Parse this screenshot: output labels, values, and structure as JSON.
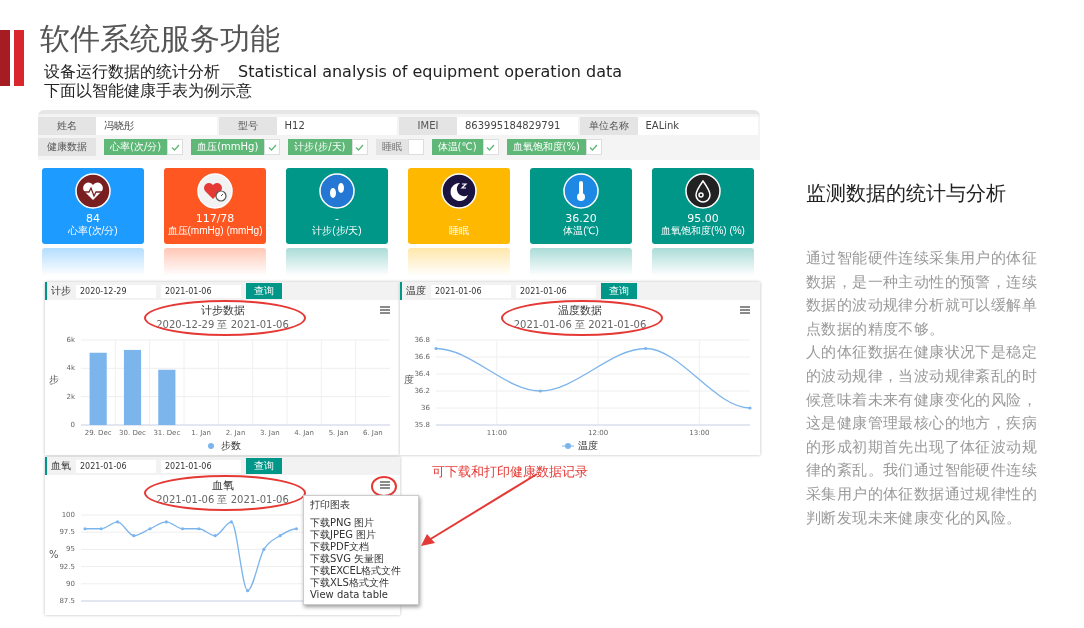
{
  "title": "软件系统服务功能",
  "subtitle": {
    "chinese": "设备运行数据的统计分析",
    "english": "Statistical analysis of equipment operation data"
  },
  "subtitle_2": "下面以智能健康手表为例示意",
  "app": {
    "info_fields": [
      {
        "label": "姓名",
        "value": "冯晓彤"
      },
      {
        "label": "型号",
        "value": "H12"
      },
      {
        "label": "IMEI",
        "value": "863995184829791"
      },
      {
        "label": "单位名称",
        "value": "EALink"
      }
    ],
    "health_label": "健康数据",
    "health_tags": [
      {
        "label": "心率(次/分)",
        "checked": true
      },
      {
        "label": "血压(mmHg)",
        "checked": true
      },
      {
        "label": "计步(步/天)",
        "checked": true
      },
      {
        "label": "睡眠",
        "checked": false
      },
      {
        "label": "体温(℃)",
        "checked": true
      },
      {
        "label": "血氧饱和度(%)",
        "checked": true
      }
    ],
    "cards": [
      {
        "kind": "heart",
        "value": "84",
        "label": "心率(次/分)",
        "color": "#1e9bff"
      },
      {
        "kind": "pressure",
        "value": "117/78",
        "label": "血压(mmHg) (mmHg)",
        "color": "#ff5722"
      },
      {
        "kind": "steps",
        "value": "-",
        "label": "计步(步/天)",
        "color": "#009688"
      },
      {
        "kind": "sleep",
        "value": "-",
        "label": "睡眠",
        "color": "#ffb800"
      },
      {
        "kind": "temperature",
        "value": "36.20",
        "label": "体温(℃)",
        "color": "#009688"
      },
      {
        "kind": "oxygen",
        "value": "95.00",
        "label": "血氧饱和度(%) (%)",
        "color": "#009688"
      }
    ],
    "charts": [
      {
        "filter_label": "计步",
        "start": "2020-12-29",
        "end": "2021-01-06",
        "button": "查询",
        "title": "计步数据",
        "range": "2020-12-29 至 2021-01-06",
        "circled": true,
        "menu_circled": false,
        "chart_data": {
          "type": "bar",
          "grid": true,
          "ylabel": "步",
          "categories": [
            "29. Dec",
            "30. Dec",
            "31. Dec",
            "1. Jan",
            "2. Jan",
            "3. Jan",
            "4. Jan",
            "5. Jan",
            "6. Jan"
          ],
          "ylim": [
            0,
            6000
          ],
          "yticks": [
            {
              "value": 0,
              "label": "0"
            },
            {
              "value": 2000,
              "label": "2k"
            },
            {
              "value": 4000,
              "label": "4k"
            },
            {
              "value": 6000,
              "label": "6k"
            }
          ],
          "series": [
            {
              "name": "步数",
              "color": "#7cb5ec",
              "values": [
                5100,
                5300,
                3900,
                null,
                null,
                null,
                null,
                null,
                null
              ]
            }
          ]
        }
      },
      {
        "filter_label": "温度",
        "start": "2021-01-06",
        "end": "2021-01-06",
        "button": "查询",
        "title": "温度数据",
        "range": "2021-01-06 至 2021-01-06",
        "circled": true,
        "menu_circled": false,
        "chart_data": {
          "type": "line",
          "grid": true,
          "ylabel": "度",
          "x": [
            10.4,
            11.43,
            12.47,
            13.5
          ],
          "xlim": [
            10.4,
            13.5
          ],
          "xticks": [
            {
              "value": 11,
              "label": "11:00"
            },
            {
              "value": 12,
              "label": "12:00"
            },
            {
              "value": 13,
              "label": "13:00"
            }
          ],
          "ylim": [
            35.8,
            36.8
          ],
          "yticks": [
            {
              "value": 35.8,
              "label": "35.8"
            },
            {
              "value": 36,
              "label": "36"
            },
            {
              "value": 36.2,
              "label": "36.2"
            },
            {
              "value": 36.4,
              "label": "36.4"
            },
            {
              "value": 36.6,
              "label": "36.6"
            },
            {
              "value": 36.8,
              "label": "36.8"
            }
          ],
          "series": [
            {
              "name": "温度",
              "color": "#7cb5ec",
              "values": [
                36.7,
                36.2,
                36.7,
                36.0
              ]
            }
          ]
        }
      },
      {
        "filter_label": "血氧",
        "start": "2021-01-06",
        "end": "2021-01-06",
        "button": "查询",
        "title": "血氧",
        "range": "2021-01-06 至 2021-01-06",
        "circled": true,
        "menu_circled": true,
        "chart_data": {
          "type": "line",
          "grid": true,
          "ylabel": "%",
          "ylim": [
            87.5,
            100
          ],
          "yticks": [
            {
              "value": 87.5,
              "label": "87.5"
            },
            {
              "value": 90,
              "label": "90"
            },
            {
              "value": 92.5,
              "label": "92.5"
            },
            {
              "value": 95,
              "label": "95"
            },
            {
              "value": 97.5,
              "label": "97.5"
            },
            {
              "value": 100,
              "label": "100"
            }
          ],
          "series": [
            {
              "color": "#7cb5ec",
              "values": [
                98,
                98,
                99,
                97,
                98,
                99,
                98,
                98,
                97,
                99,
                89,
                95,
                97,
                98
              ]
            }
          ]
        }
      }
    ],
    "export_menu": [
      "打印图表",
      "下载PNG 图片",
      "下载JPEG 图片",
      "下载PDF文档",
      "下载SVG 矢量图",
      "下载EXCEL格式文件",
      "下载XLS格式文件",
      "View data table"
    ],
    "note": "可下载和打印健康数据记录"
  },
  "side": {
    "heading": "监测数据的统计与分析",
    "paragraphs": [
      "通过智能硬件连续采集用户的体征数据，是一种主动性的预警，连续数据的波动规律分析就可以缓解单点数据的精度不够。",
      "人的体征数据在健康状况下是稳定的波动规律，当波动规律紊乱的时候意味着未来有健康变化的风险，这是健康管理最核心的地方，疾病的形成初期首先出现了体征波动规律的紊乱。我们通过智能硬件连续采集用户的体征数据通过规律性的判断发现未来健康变化的风险。"
    ]
  }
}
